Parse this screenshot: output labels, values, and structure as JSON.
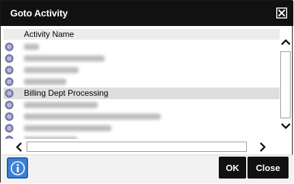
{
  "dialog": {
    "title": "Goto Activity",
    "close_icon": "close-x-icon"
  },
  "list": {
    "column_header": "Activity Name",
    "rows": [
      {
        "label": "",
        "blurred": true
      },
      {
        "label": "",
        "blurred": true
      },
      {
        "label": "",
        "blurred": true
      },
      {
        "label": "",
        "blurred": true
      },
      {
        "label": "Billing Dept Processing",
        "blurred": false,
        "selected": true
      },
      {
        "label": "",
        "blurred": true
      },
      {
        "label": "",
        "blurred": true
      },
      {
        "label": "",
        "blurred": true
      },
      {
        "label": "",
        "blurred": true
      }
    ]
  },
  "scroll": {
    "up_icon": "chevron-up-icon",
    "down_icon": "chevron-down-icon",
    "left_icon": "chevron-left-icon",
    "right_icon": "chevron-right-icon"
  },
  "footer": {
    "info_icon": "info-icon",
    "ok_label": "OK",
    "close_label": "Close"
  },
  "colors": {
    "titlebar": "#111111",
    "button": "#111111",
    "info_button": "#3b82d6",
    "selected_row": "#dedede"
  }
}
